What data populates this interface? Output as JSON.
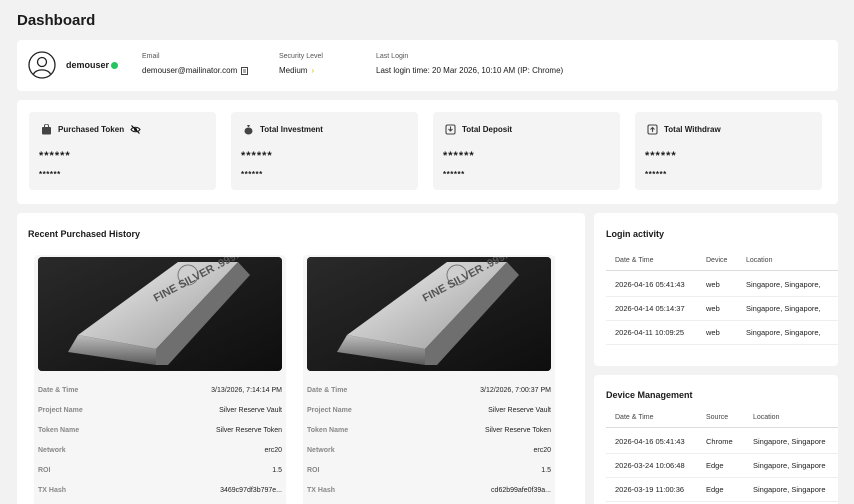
{
  "page": {
    "title": "Dashboard"
  },
  "profile": {
    "username": "demouser",
    "email_label": "Email",
    "email": "demouser@mailinator.com",
    "security_label": "Security Level",
    "security_value": "Medium",
    "last_login_label": "Last Login",
    "last_login_value": "Last login time: 20 Mar 2026, 10:10 AM (IP: Chrome)"
  },
  "stats": [
    {
      "label": "Purchased Token",
      "value": "******",
      "sub": "******",
      "icon": "bag-icon"
    },
    {
      "label": "Total Investment",
      "value": "******",
      "sub": "******",
      "icon": "money-bag-icon"
    },
    {
      "label": "Total Deposit",
      "value": "******",
      "sub": "******",
      "icon": "deposit-icon"
    },
    {
      "label": "Total Withdraw",
      "value": "******",
      "sub": "******",
      "icon": "withdraw-icon"
    }
  ],
  "history": {
    "title": "Recent Purchased History",
    "labels": {
      "date": "Date & Time",
      "project": "Project Name",
      "token": "Token Name",
      "network": "Network",
      "roi": "ROI",
      "tx": "TX Hash"
    },
    "items": [
      {
        "bar_text": "FINE SILVER .999.9 1000g",
        "date": "3/13/2026, 7:14:14 PM",
        "project": "Silver Reserve Vault",
        "token": "Silver Reserve Token",
        "network": "erc20",
        "roi": "1.5",
        "tx": "3469c97df3b797e..."
      },
      {
        "bar_text": "FINE SILVER .999.9 1000g",
        "date": "3/12/2026, 7:00:37 PM",
        "project": "Silver Reserve Vault",
        "token": "Silver Reserve Token",
        "network": "erc20",
        "roi": "1.5",
        "tx": "cd62b99afe0f39a..."
      }
    ]
  },
  "login_activity": {
    "title": "Login activity",
    "headers": [
      "Date & Time",
      "Device",
      "Location"
    ],
    "rows": [
      [
        "2026-04-16 05:41:43",
        "web",
        "Singapore, Singapore,"
      ],
      [
        "2026-04-14 05:14:37",
        "web",
        "Singapore, Singapore,"
      ],
      [
        "2026-04-11 10:09:25",
        "web",
        "Singapore, Singapore,"
      ]
    ]
  },
  "device_management": {
    "title": "Device Management",
    "headers": [
      "Date & Time",
      "Source",
      "Location"
    ],
    "rows": [
      [
        "2026-04-16 05:41:43",
        "Chrome",
        "Singapore, Singapore"
      ],
      [
        "2026-03-24 10:06:48",
        "Edge",
        "Singapore, Singapore"
      ],
      [
        "2026-03-19 11:00:36",
        "Edge",
        "Singapore, Singapore"
      ]
    ]
  },
  "colors": {
    "online": "#22c55e",
    "accent": "#e5b100"
  }
}
